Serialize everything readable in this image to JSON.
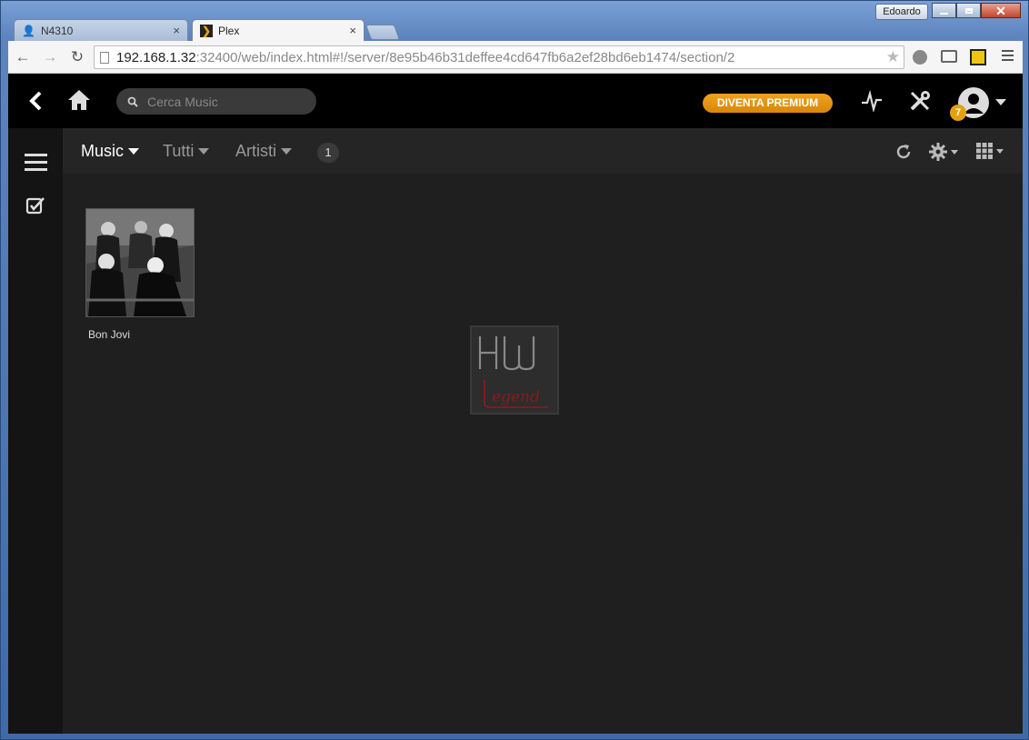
{
  "window": {
    "profile_name": "Edoardo"
  },
  "tabs": [
    {
      "title": "N4310",
      "close": "×"
    },
    {
      "title": "Plex",
      "close": "×"
    }
  ],
  "toolbar": {
    "url_host": "192.168.1.32",
    "url_rest": ":32400/web/index.html#!/server/8e95b46b31deffee4cd647fb6a2ef28bd6eb1474/section/2"
  },
  "plex": {
    "search_placeholder": "Cerca Music",
    "premium_label": "DIVENTA PREMIUM",
    "notification_count": "7",
    "filters": {
      "library": "Music",
      "scope": "Tutti",
      "type": "Artisti",
      "count": "1"
    },
    "items": [
      {
        "title": "Bon Jovi"
      }
    ],
    "colors": {
      "accent": "#e5a00d",
      "background": "#1f1f1f",
      "topbar": "#000000"
    }
  }
}
